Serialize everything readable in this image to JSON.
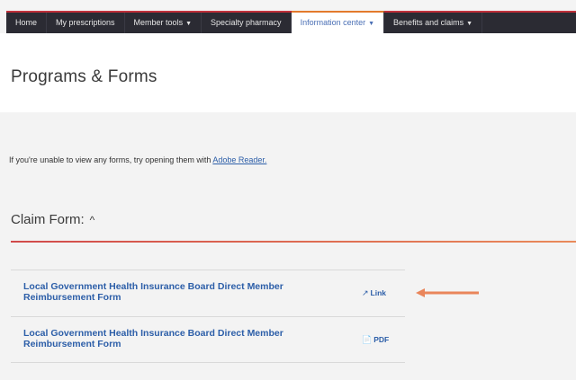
{
  "nav": {
    "items": [
      {
        "label": "Home",
        "dropdown": false,
        "active": false
      },
      {
        "label": "My prescriptions",
        "dropdown": false,
        "active": false
      },
      {
        "label": "Member tools",
        "dropdown": true,
        "active": false
      },
      {
        "label": "Specialty pharmacy",
        "dropdown": false,
        "active": false
      },
      {
        "label": "Information center",
        "dropdown": true,
        "active": true
      },
      {
        "label": "Benefits and claims",
        "dropdown": true,
        "active": false
      }
    ]
  },
  "page_title": "Programs & Forms",
  "info": {
    "text": "If you're unable to view any forms, try opening them with ",
    "link_label": "Adobe Reader."
  },
  "section": {
    "title": "Claim Form:",
    "caret": "^"
  },
  "forms": [
    {
      "name": "Local Government Health Insurance Board Direct Member Reimbursement Form",
      "action_label": "Link",
      "action_icon": "external-link-icon"
    },
    {
      "name": "Local Government Health Insurance Board Direct Member Reimbursement Form",
      "action_label": "PDF",
      "action_icon": "pdf-icon"
    }
  ],
  "colors": {
    "nav_bg": "#2b2b33",
    "accent_red": "#c0303a",
    "accent_orange": "#e37a2c",
    "link_blue": "#2c5ea8"
  }
}
